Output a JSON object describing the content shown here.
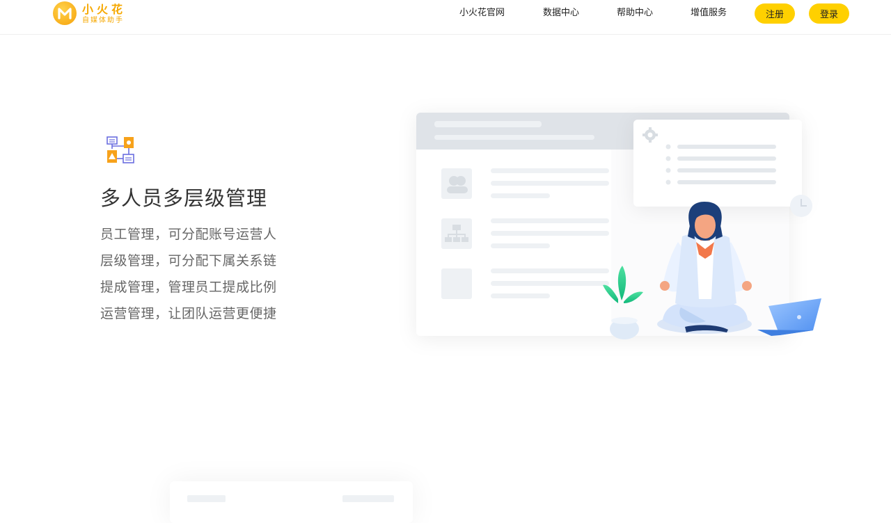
{
  "brand": {
    "mark": "M",
    "title": "小火花",
    "subtitle": "自媒体助手"
  },
  "nav": {
    "links": [
      {
        "label": "小火花官网"
      },
      {
        "label": "数据中心"
      },
      {
        "label": "帮助中心"
      },
      {
        "label": "增值服务"
      }
    ],
    "register_label": "注册",
    "login_label": "登录"
  },
  "feature": {
    "icon": "hierarchy-icon",
    "title": "多人员多层级管理",
    "items": [
      "员工管理，可分配账号运营人",
      "层级管理，可分配下属关系链",
      "提成管理，管理员工提成比例",
      "运营管理，让团队运营更便捷"
    ]
  },
  "colors": {
    "accent": "#ffd000",
    "brand": "#f6a800",
    "title_text": "#333333",
    "body_text": "#666666"
  }
}
